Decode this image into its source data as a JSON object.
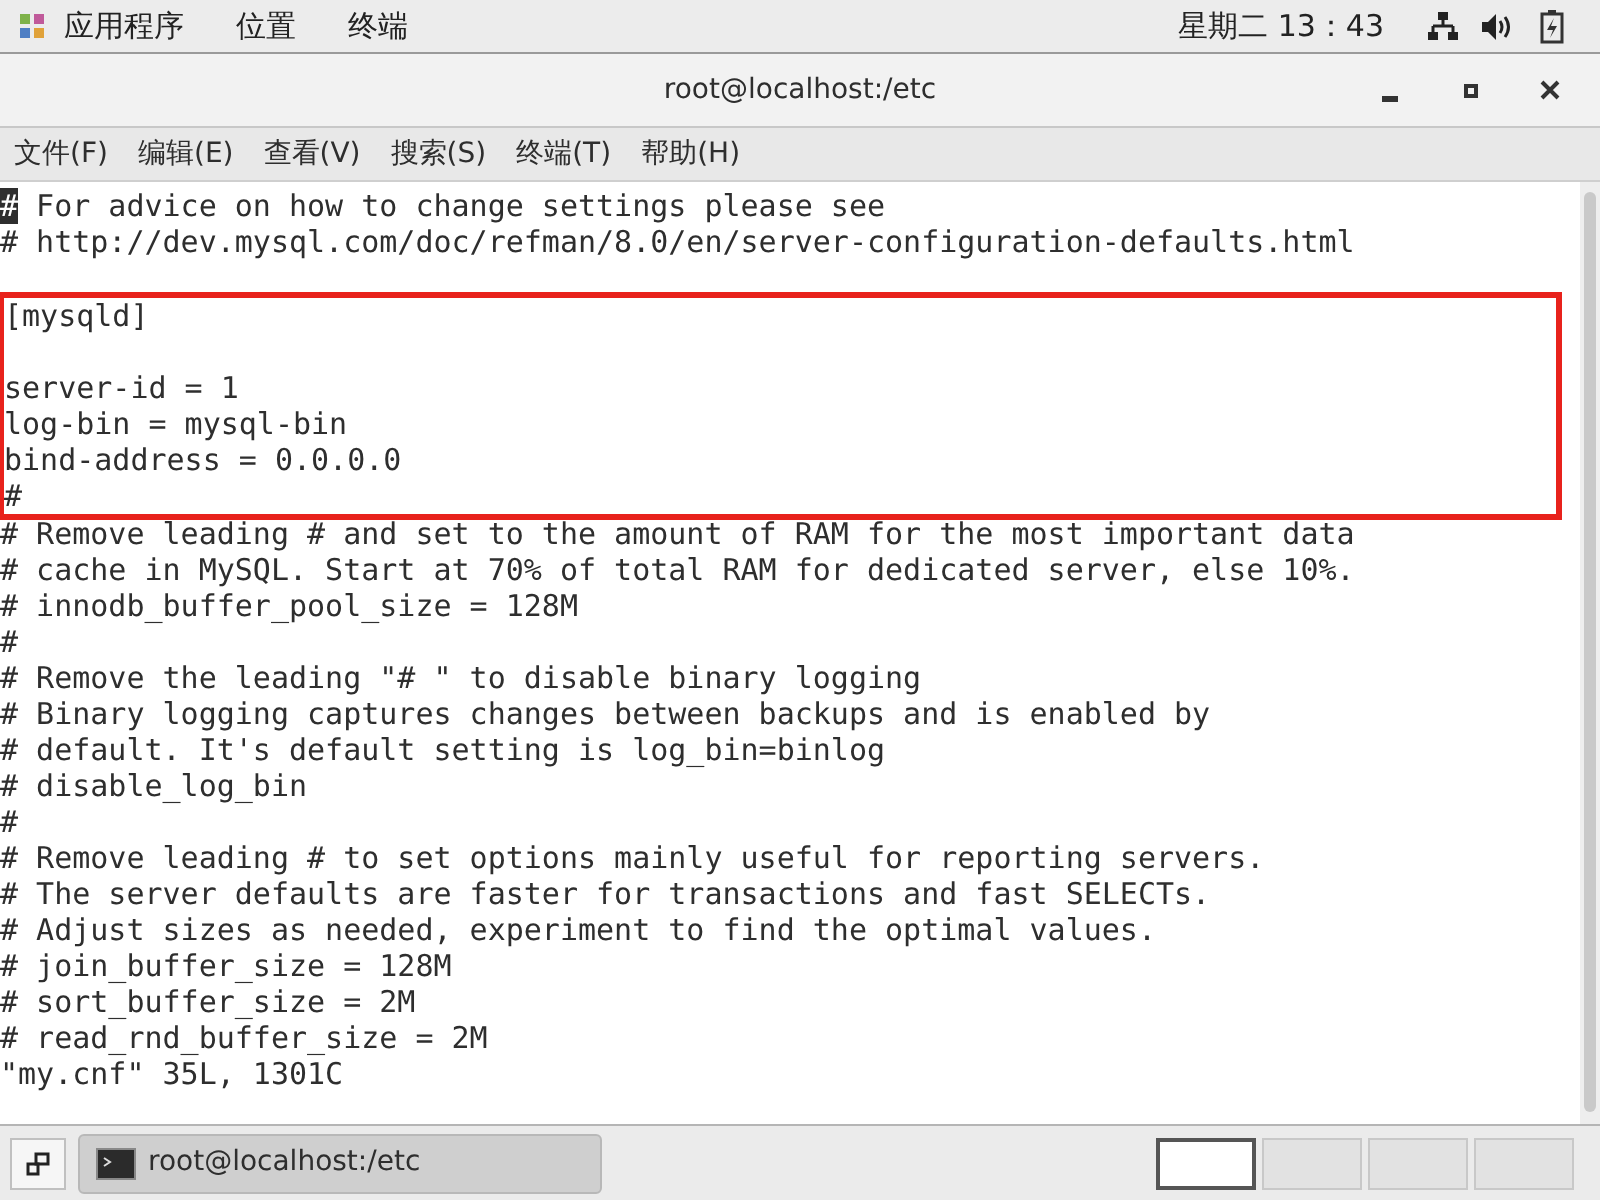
{
  "top_bar": {
    "menus": [
      "应用程序",
      "位置",
      "终端"
    ],
    "clock": "星期二 13：43"
  },
  "window": {
    "title": "root@localhost:/etc"
  },
  "menu_bar": [
    "文件(F)",
    "编辑(E)",
    "查看(V)",
    "搜索(S)",
    "终端(T)",
    "帮助(H)"
  ],
  "terminal": {
    "blocks": [
      {
        "highlighted": false,
        "lines": [
          {
            "kind": "text",
            "text": "# For advice on how to change settings please see",
            "cursor": true
          },
          {
            "kind": "text",
            "text": "# http://dev.mysql.com/doc/refman/8.0/en/server-configuration-defaults.html",
            "cursor": false
          },
          {
            "kind": "blank"
          }
        ]
      },
      {
        "highlighted": true,
        "lines": [
          {
            "kind": "text",
            "text": "[mysqld]",
            "cursor": false
          },
          {
            "kind": "blank"
          },
          {
            "kind": "text",
            "text": "server-id = 1",
            "cursor": false
          },
          {
            "kind": "text",
            "text": "log-bin = mysql-bin",
            "cursor": false
          },
          {
            "kind": "text",
            "text": "bind-address = 0.0.0.0",
            "cursor": false
          },
          {
            "kind": "text",
            "text": "#",
            "cursor": false
          }
        ]
      },
      {
        "highlighted": false,
        "lines": [
          {
            "kind": "text",
            "text": "# Remove leading # and set to the amount of RAM for the most important data",
            "cursor": false
          },
          {
            "kind": "text",
            "text": "# cache in MySQL. Start at 70% of total RAM for dedicated server, else 10%.",
            "cursor": false
          },
          {
            "kind": "text",
            "text": "# innodb_buffer_pool_size = 128M",
            "cursor": false
          },
          {
            "kind": "text",
            "text": "#",
            "cursor": false
          },
          {
            "kind": "text",
            "text": "# Remove the leading \"# \" to disable binary logging",
            "cursor": false
          },
          {
            "kind": "text",
            "text": "# Binary logging captures changes between backups and is enabled by",
            "cursor": false
          },
          {
            "kind": "text",
            "text": "# default. It's default setting is log_bin=binlog",
            "cursor": false
          },
          {
            "kind": "text",
            "text": "# disable_log_bin",
            "cursor": false
          },
          {
            "kind": "text",
            "text": "#",
            "cursor": false
          },
          {
            "kind": "text",
            "text": "# Remove leading # to set options mainly useful for reporting servers.",
            "cursor": false
          },
          {
            "kind": "text",
            "text": "# The server defaults are faster for transactions and fast SELECTs.",
            "cursor": false
          },
          {
            "kind": "text",
            "text": "# Adjust sizes as needed, experiment to find the optimal values.",
            "cursor": false
          },
          {
            "kind": "text",
            "text": "# join_buffer_size = 128M",
            "cursor": false
          },
          {
            "kind": "text",
            "text": "# sort_buffer_size = 2M",
            "cursor": false
          },
          {
            "kind": "text",
            "text": "# read_rnd_buffer_size = 2M",
            "cursor": false
          },
          {
            "kind": "text",
            "text": "\"my.cnf\" 35L, 1301C",
            "cursor": false
          }
        ]
      }
    ]
  },
  "taskbar": {
    "tasks": [
      {
        "label": "root@localhost:/etc",
        "selected": true
      }
    ],
    "workspaces": [
      {
        "selected": true
      },
      {
        "selected": false
      },
      {
        "selected": false
      },
      {
        "selected": false
      }
    ]
  }
}
